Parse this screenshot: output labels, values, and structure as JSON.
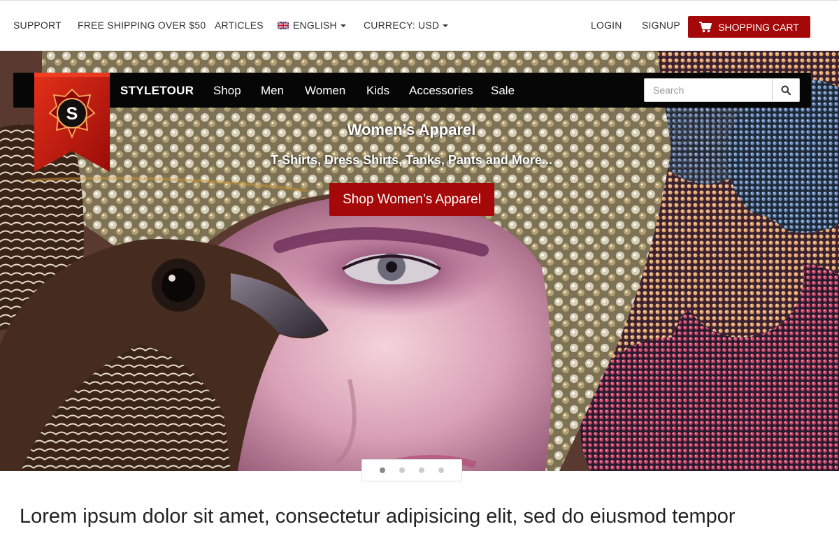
{
  "topbar": {
    "support": "SUPPORT",
    "free_shipping": "FREE SHIPPING OVER $50",
    "articles": "ARTICLES",
    "language": "ENGLISH",
    "currency": "CURRECY: USD",
    "login": "LOGIN",
    "signup": "SIGNUP",
    "cart": "SHOPPING CART"
  },
  "nav": {
    "brand": "STYLETOUR",
    "logo_letter": "S",
    "links": [
      "Shop",
      "Men",
      "Women",
      "Kids",
      "Accessories",
      "Sale"
    ],
    "search_placeholder": "Search"
  },
  "hero": {
    "title": "Women’s Apparel",
    "subtitle": "T-Shirts, Dress Shirts, Tanks, Pants and More...",
    "cta": "Shop Women’s Apparel",
    "slide_count": 4,
    "active_slide": 1
  },
  "content": {
    "lead": "Lorem ipsum dolor sit amet, consectetur adipisicing elit, sed do eiusmod tempor"
  },
  "colors": {
    "accent": "#a50808",
    "nav_bg": "#060606"
  },
  "icons": {
    "cart": "shopping-cart-icon",
    "search": "search-icon",
    "flag": "uk-flag-icon",
    "caret": "caret-down-icon"
  }
}
